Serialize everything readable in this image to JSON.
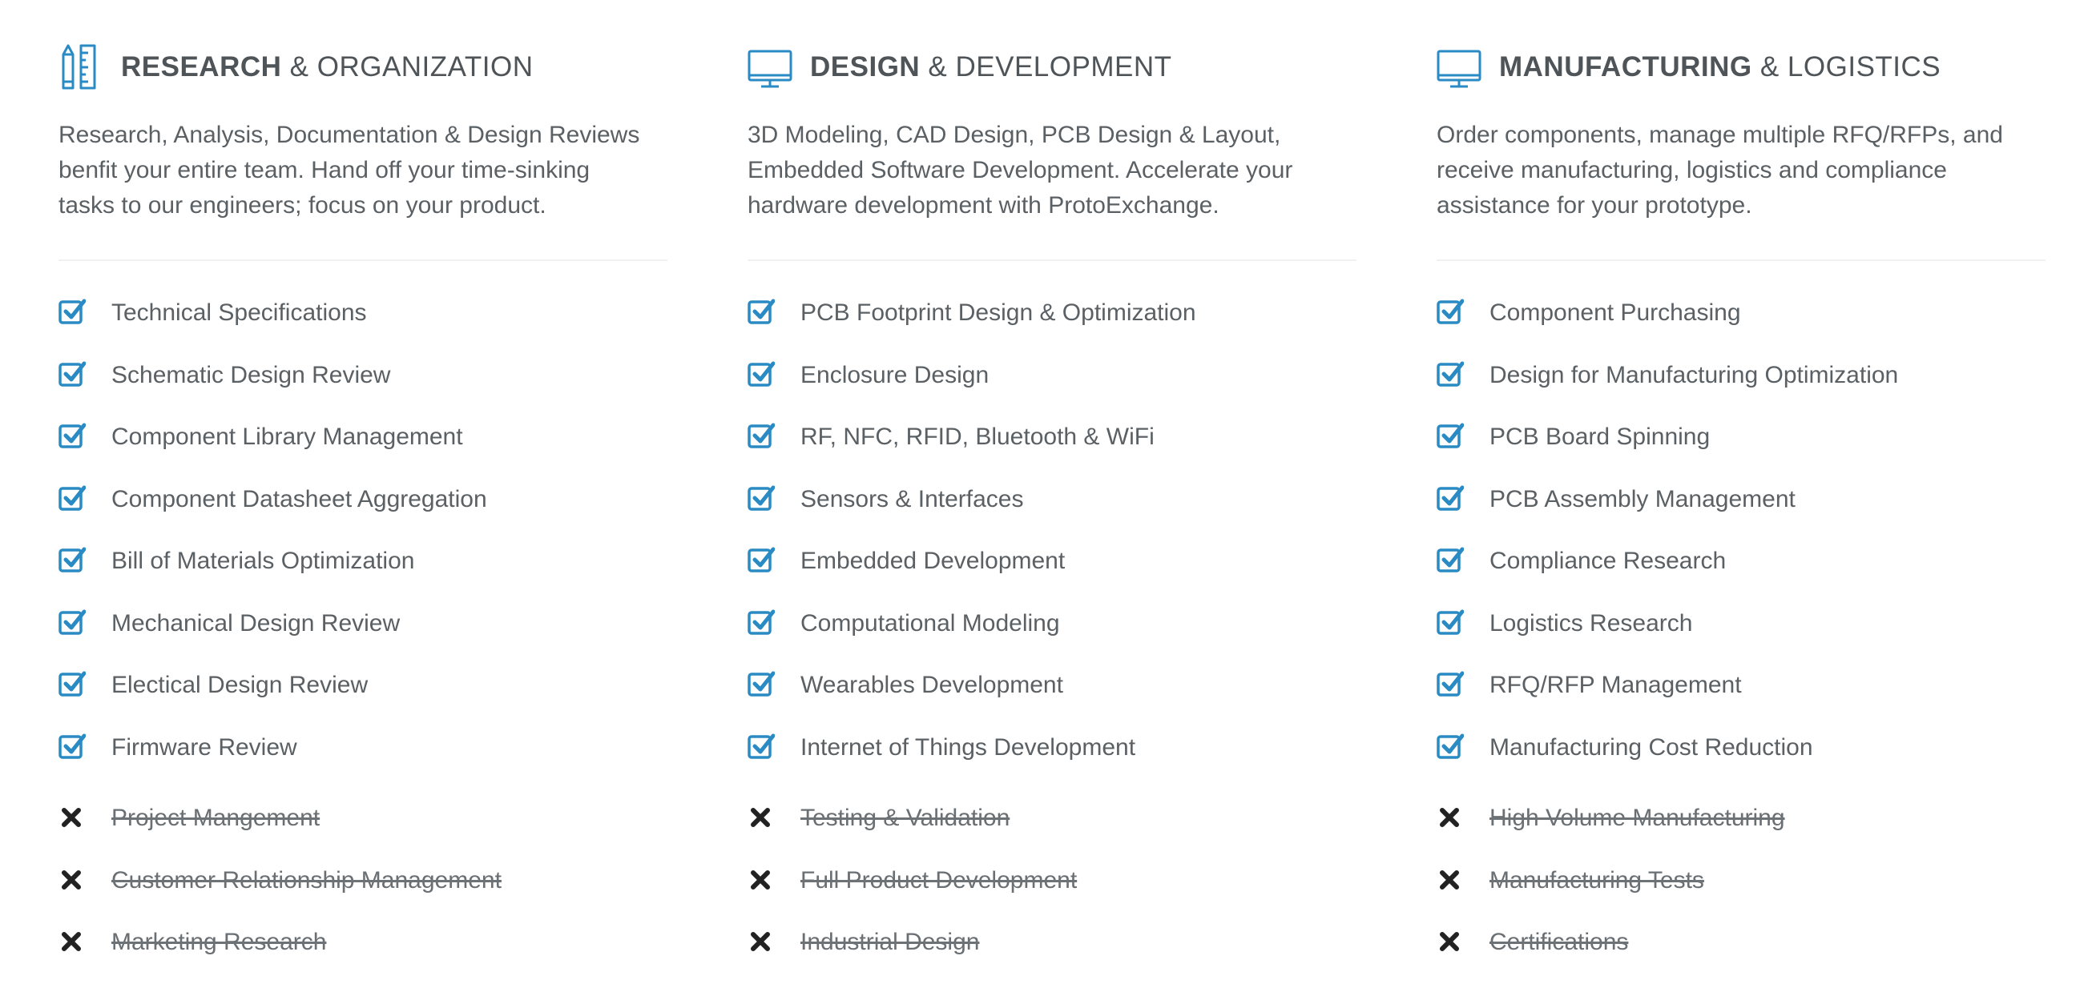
{
  "colors": {
    "accent": "#2a8bc4",
    "text": "#5b6064",
    "heading": "#4f5458",
    "divider": "#f0f1f2",
    "x_mark": "#222222"
  },
  "columns": [
    {
      "icon": "ruler-pencil-icon",
      "title_strong": "RESEARCH",
      "title_light": " & ORGANIZATION",
      "desc_lines": [
        "Research, Analysis, Documentation & Design Reviews",
        "benfit your entire team. Hand off your time-sinking",
        "tasks to our engineers; focus on your product."
      ],
      "included": [
        "Technical Specifications",
        "Schematic Design Review",
        "Component Library Management",
        "Component Datasheet Aggregation",
        "Bill of Materials Optimization",
        "Mechanical Design Review",
        "Electical Design Review",
        "Firmware Review"
      ],
      "excluded": [
        "Project Mangement",
        "Customer Relationship Management",
        "Marketing Research"
      ]
    },
    {
      "icon": "monitor-icon",
      "title_strong": "DESIGN",
      "title_light": " & DEVELOPMENT",
      "desc_lines": [
        "3D Modeling, CAD Design, PCB Design & Layout,",
        "Embedded Software Development. Accelerate your",
        "hardware development with ProtoExchange."
      ],
      "included": [
        "PCB Footprint Design & Optimization",
        "Enclosure Design",
        "RF, NFC, RFID, Bluetooth & WiFi",
        "Sensors & Interfaces",
        "Embedded Development",
        "Computational Modeling",
        "Wearables Development",
        "Internet of Things Development"
      ],
      "excluded": [
        "Testing & Validation",
        "Full Product Development",
        "Industrial Design"
      ]
    },
    {
      "icon": "monitor-icon",
      "title_strong": "MANUFACTURING",
      "title_light": " & LOGISTICS",
      "desc_lines": [
        "Order components, manage multiple RFQ/RFPs, and",
        "receive manufacturing, logistics and compliance",
        "assistance for your prototype."
      ],
      "included": [
        "Component Purchasing",
        "Design for Manufacturing Optimization",
        "PCB Board Spinning",
        "PCB Assembly Management",
        "Compliance Research",
        "Logistics Research",
        "RFQ/RFP Management",
        "Manufacturing Cost Reduction"
      ],
      "excluded": [
        "High Volume Manufacturing",
        "Manufacturing Tests",
        "Certifications"
      ]
    }
  ]
}
